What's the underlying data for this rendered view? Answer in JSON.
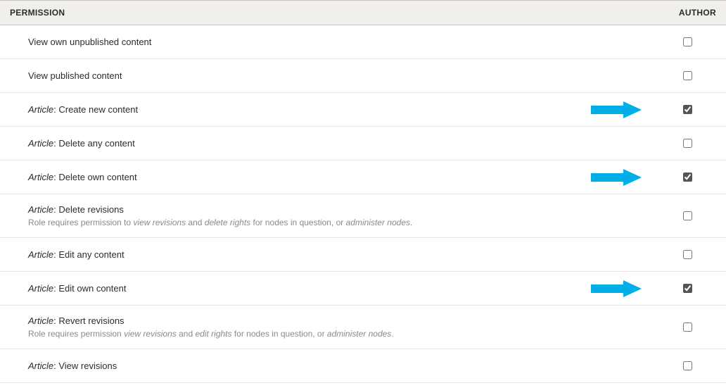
{
  "headers": {
    "permission": "PERMISSION",
    "role": "AUTHOR"
  },
  "arrow_color": "#00aee8",
  "permissions": [
    {
      "prefix": "",
      "label": "View own unpublished content",
      "desc_plain": "",
      "desc_em1": "",
      "desc_mid": "",
      "desc_em2": "",
      "desc_tail": "",
      "desc_em3": "",
      "checked": false,
      "arrow": false
    },
    {
      "prefix": "",
      "label": "View published content",
      "desc_plain": "",
      "desc_em1": "",
      "desc_mid": "",
      "desc_em2": "",
      "desc_tail": "",
      "desc_em3": "",
      "checked": false,
      "arrow": false
    },
    {
      "prefix": "Article",
      "label": ": Create new content",
      "desc_plain": "",
      "desc_em1": "",
      "desc_mid": "",
      "desc_em2": "",
      "desc_tail": "",
      "desc_em3": "",
      "checked": true,
      "arrow": true
    },
    {
      "prefix": "Article",
      "label": ": Delete any content",
      "desc_plain": "",
      "desc_em1": "",
      "desc_mid": "",
      "desc_em2": "",
      "desc_tail": "",
      "desc_em3": "",
      "checked": false,
      "arrow": false
    },
    {
      "prefix": "Article",
      "label": ": Delete own content",
      "desc_plain": "",
      "desc_em1": "",
      "desc_mid": "",
      "desc_em2": "",
      "desc_tail": "",
      "desc_em3": "",
      "checked": true,
      "arrow": true
    },
    {
      "prefix": "Article",
      "label": ": Delete revisions",
      "desc_plain": "Role requires permission to ",
      "desc_em1": "view revisions",
      "desc_mid": " and ",
      "desc_em2": "delete rights",
      "desc_tail": " for nodes in question, or ",
      "desc_em3": "administer nodes",
      "checked": false,
      "arrow": false
    },
    {
      "prefix": "Article",
      "label": ": Edit any content",
      "desc_plain": "",
      "desc_em1": "",
      "desc_mid": "",
      "desc_em2": "",
      "desc_tail": "",
      "desc_em3": "",
      "checked": false,
      "arrow": false
    },
    {
      "prefix": "Article",
      "label": ": Edit own content",
      "desc_plain": "",
      "desc_em1": "",
      "desc_mid": "",
      "desc_em2": "",
      "desc_tail": "",
      "desc_em3": "",
      "checked": true,
      "arrow": true
    },
    {
      "prefix": "Article",
      "label": ": Revert revisions",
      "desc_plain": "Role requires permission ",
      "desc_em1": "view revisions",
      "desc_mid": " and ",
      "desc_em2": "edit rights",
      "desc_tail": " for nodes in question, or ",
      "desc_em3": "administer nodes",
      "checked": false,
      "arrow": false
    },
    {
      "prefix": "Article",
      "label": ": View revisions",
      "desc_plain": "",
      "desc_em1": "",
      "desc_mid": "",
      "desc_em2": "",
      "desc_tail": "",
      "desc_em3": "",
      "checked": false,
      "arrow": false
    }
  ]
}
